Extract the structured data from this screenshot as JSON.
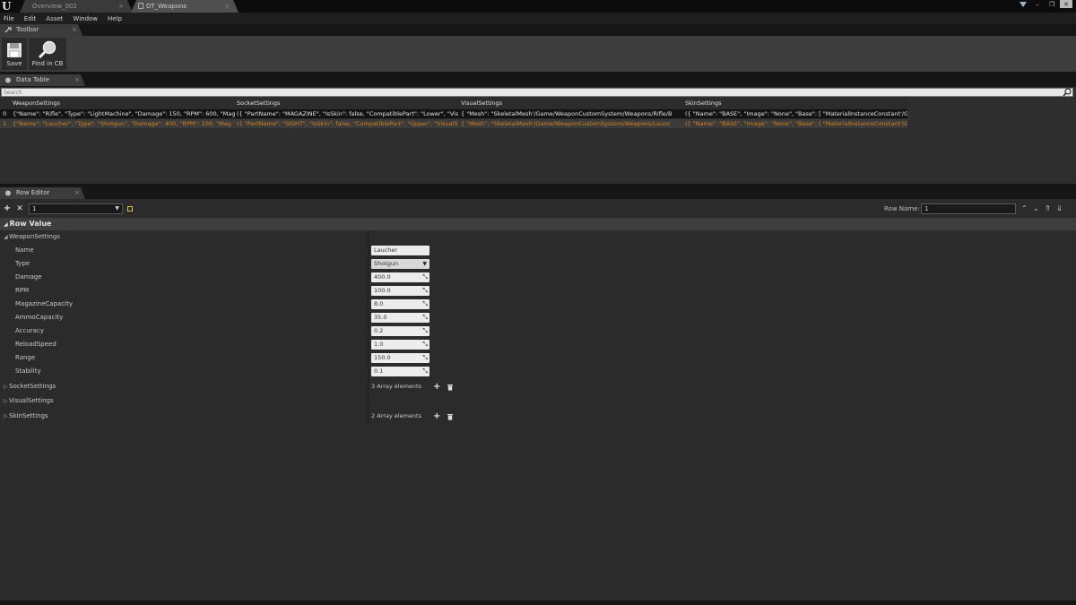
{
  "window": {
    "logo": "U",
    "tabs": [
      {
        "label": "Overview_002",
        "active": false
      },
      {
        "label": "DT_Weapons",
        "active": true
      }
    ]
  },
  "menu": [
    "File",
    "Edit",
    "Asset",
    "Window",
    "Help"
  ],
  "toolbar_panel": {
    "tab_label": "Toolbar",
    "buttons": [
      {
        "label": "Save",
        "icon": "save-icon"
      },
      {
        "label": "Find in CB",
        "icon": "find-in-cb-icon"
      }
    ]
  },
  "data_table": {
    "tab_label": "Data Table",
    "search_placeholder": "Search",
    "columns": [
      "WeaponSettings",
      "SocketSettings",
      "VisualSettings",
      "SkinSettings"
    ],
    "rows": [
      {
        "index": "0",
        "selected": false,
        "cells": [
          "{\"Name\": \"Rifle\", \"Type\": \"LightMachine\", \"Damage\": 150, \"RPM\": 600, \"Mag",
          "({ \"PartName\": \"MAGAZINE\", \"IsSkin\": false, \"CompatiblePart\": \"Lower\", \"Vis",
          "{ \"Mesh\": \"SkeletalMesh'/Game/WeaponCustomSystem/Weapons/Rifle/B",
          "({ \"Name\": \"BASE\", \"Image\": \"None\", \"Base\": [ \"MaterialInstanceConstant'/G"
        ]
      },
      {
        "index": "1",
        "selected": true,
        "cells": [
          "{\"Name\": \"Laucher\", \"Type\": \"Shotgun\", \"Damage\": 400, \"RPM\": 100, \"Mag",
          "({ \"PartName\": \"SIGHT\", \"IsSkin\": false, \"CompatiblePart\": \"Upper\", \"VisualS",
          "{ \"Mesh\": \"SkeletalMesh'/Game/WeaponCustomSystem/Weapons/Launc",
          "({ \"Name\": \"BASE\", \"Image\": \"None\", \"Base\": [ \"MaterialInstanceConstant'/G"
        ]
      }
    ]
  },
  "row_editor": {
    "tab_label": "Row Editor",
    "selected_row": "1",
    "row_name_label": "Row Name:",
    "row_name_value": "1",
    "row_value_label": "Row Value",
    "weapon_settings": {
      "label": "WeaponSettings",
      "name": {
        "label": "Name",
        "value": "Laucher"
      },
      "type": {
        "label": "Type",
        "value": "Shotgun"
      },
      "damage": {
        "label": "Damage",
        "value": "400.0"
      },
      "rpm": {
        "label": "RPM",
        "value": "100.0"
      },
      "magazine_capacity": {
        "label": "MagazineCapacity",
        "value": "8.0"
      },
      "ammo_capacity": {
        "label": "AmmoCapacity",
        "value": "35.0"
      },
      "accuracy": {
        "label": "Accuracy",
        "value": "0.2"
      },
      "reload_speed": {
        "label": "ReloadSpeed",
        "value": "1.0"
      },
      "range": {
        "label": "Range",
        "value": "150.0"
      },
      "stability": {
        "label": "Stability",
        "value": "0.1"
      }
    },
    "socket_settings": {
      "label": "SocketSettings",
      "summary": "3 Array elements"
    },
    "visual_settings": {
      "label": "VisualSettings"
    },
    "skin_settings": {
      "label": "SkinSettings",
      "summary": "2 Array elements"
    }
  },
  "colors": {
    "selected_row_text": "#d9821c",
    "panel_bg": "#2b2b2b",
    "field_bg": "#ececec"
  }
}
